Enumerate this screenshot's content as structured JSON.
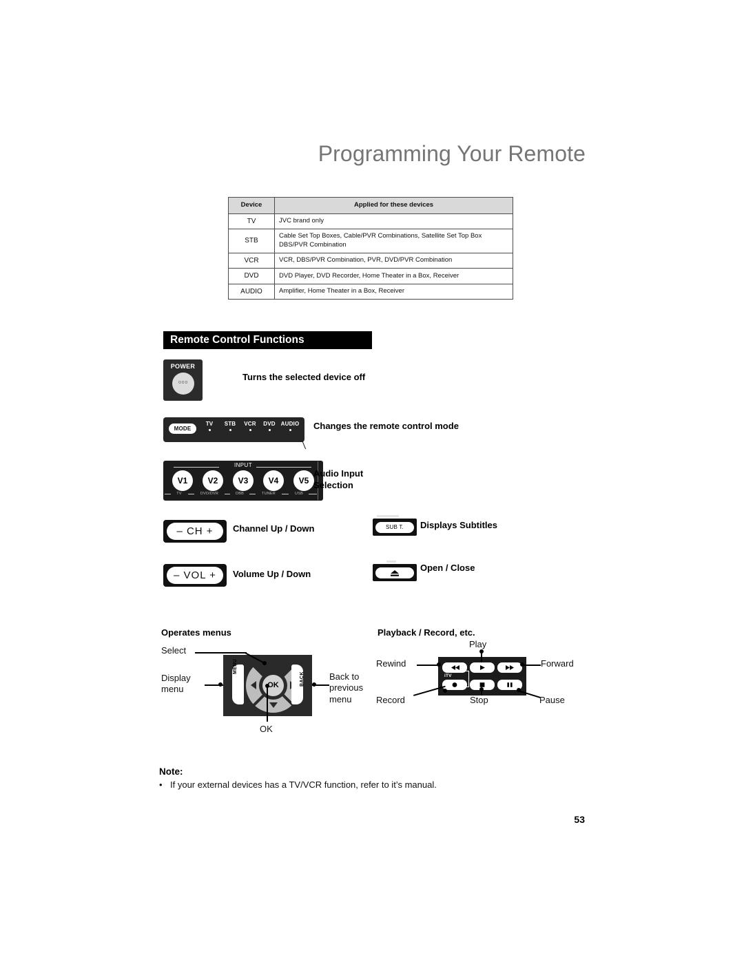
{
  "document": {
    "title": "Programming Your Remote",
    "page_number": "53"
  },
  "device_table": {
    "headers": [
      "Device",
      "Applied for these devices"
    ],
    "rows": [
      {
        "device": "TV",
        "applied": "JVC brand only"
      },
      {
        "device": "STB",
        "applied": "Cable Set Top Boxes, Cable/PVR Combinations, Satellite Set Top Box DBS/PVR Combination"
      },
      {
        "device": "VCR",
        "applied": "VCR, DBS/PVR Combination, PVR, DVD/PVR Combination"
      },
      {
        "device": "DVD",
        "applied": "DVD Player, DVD Recorder, Home Theater in a Box, Receiver"
      },
      {
        "device": "AUDIO",
        "applied": "Amplifier, Home Theater in a Box, Receiver"
      }
    ]
  },
  "section": {
    "heading": "Remote Control Functions"
  },
  "functions": {
    "power": {
      "key_label": "POWER",
      "key_dots": "ooo",
      "description": "Turns the selected device off"
    },
    "mode": {
      "button_label": "MODE",
      "indicators": [
        "TV",
        "STB",
        "VCR",
        "DVD",
        "AUDIO"
      ],
      "description": "Changes the remote control mode"
    },
    "input": {
      "group_label": "INPUT",
      "buttons": [
        "V1",
        "V2",
        "V3",
        "V4",
        "V5"
      ],
      "sub_labels": [
        "TV",
        "DVD/DVR",
        "DBB",
        "TUNER",
        "USB"
      ],
      "description_line1": "Audio Input",
      "description_line2": "Selection"
    },
    "channel": {
      "key_label": "– CH +",
      "description": "Channel Up / Down"
    },
    "volume": {
      "key_label": "– VOL +",
      "description": "Volume Up / Down"
    },
    "subtitle": {
      "key_label": "SUB T.",
      "description": "Displays Subtitles"
    },
    "open_close": {
      "key_label": "eject-icon",
      "description": "Open / Close"
    }
  },
  "menu_section": {
    "heading": "Operates menus",
    "callouts": {
      "select": "Select",
      "display_menu_line1": "Display",
      "display_menu_line2": "menu",
      "back_line1": "Back to",
      "back_line2": "previous",
      "back_line3": "menu",
      "ok": "OK"
    },
    "pad": {
      "center_label": "OK",
      "left_label": "MENU",
      "right_label": "BACK"
    }
  },
  "playback_section": {
    "heading": "Playback / Record, etc.",
    "itv_label": "iTV",
    "callouts": {
      "play": "Play",
      "rewind": "Rewind",
      "forward": "Forward",
      "record": "Record",
      "stop": "Stop",
      "pause": "Pause"
    }
  },
  "note": {
    "title": "Note:",
    "bullet": "•",
    "text": "If your external devices has a TV/VCR function, refer to it’s manual."
  },
  "colors": {
    "title_gray": "#757575",
    "bar_black": "#000000",
    "table_header_gray": "#d9d9d9",
    "key_dark": "#1c1c1c"
  }
}
